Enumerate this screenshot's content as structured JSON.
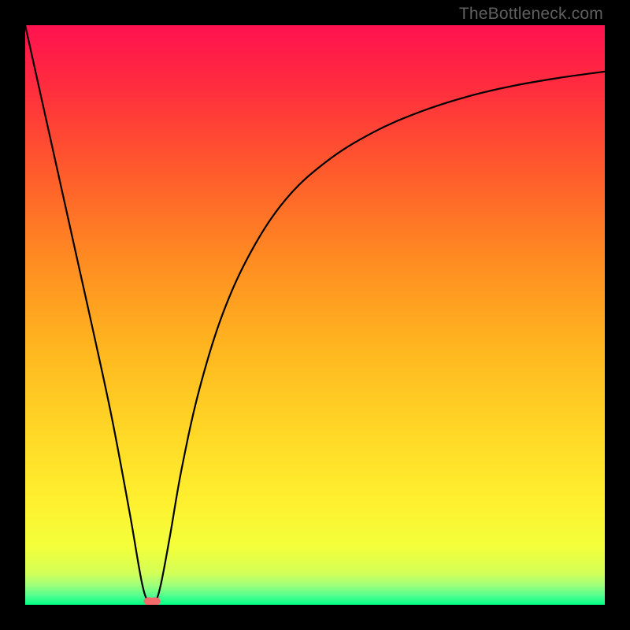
{
  "attribution": "TheBottleneck.com",
  "colors": {
    "bg_black": "#000000",
    "gradient_stops": [
      {
        "offset": 0.0,
        "color": "#ff1250"
      },
      {
        "offset": 0.1,
        "color": "#ff2b3f"
      },
      {
        "offset": 0.25,
        "color": "#ff5a2c"
      },
      {
        "offset": 0.4,
        "color": "#ff8a22"
      },
      {
        "offset": 0.55,
        "color": "#ffb41f"
      },
      {
        "offset": 0.7,
        "color": "#ffd726"
      },
      {
        "offset": 0.82,
        "color": "#fff02f"
      },
      {
        "offset": 0.9,
        "color": "#f3ff3a"
      },
      {
        "offset": 0.945,
        "color": "#d4ff57"
      },
      {
        "offset": 0.965,
        "color": "#a2ff78"
      },
      {
        "offset": 0.983,
        "color": "#58ff8e"
      },
      {
        "offset": 1.0,
        "color": "#00ff87"
      }
    ],
    "curve_stroke": "#000000",
    "marker_fill": "#f26a6a"
  },
  "chart_data": {
    "type": "line",
    "title": "",
    "xlabel": "",
    "ylabel": "",
    "xlim": [
      0,
      1
    ],
    "ylim": [
      0,
      1
    ],
    "series": [
      {
        "name": "bottleneck-curve",
        "x": [
          0.0,
          0.03,
          0.06,
          0.09,
          0.12,
          0.15,
          0.18,
          0.202,
          0.214,
          0.224,
          0.234,
          0.25,
          0.27,
          0.3,
          0.34,
          0.39,
          0.45,
          0.52,
          0.6,
          0.68,
          0.76,
          0.84,
          0.92,
          1.0
        ],
        "y": [
          1.0,
          0.865,
          0.73,
          0.595,
          0.46,
          0.32,
          0.16,
          0.035,
          0.005,
          0.005,
          0.035,
          0.12,
          0.235,
          0.37,
          0.5,
          0.61,
          0.7,
          0.765,
          0.815,
          0.85,
          0.876,
          0.895,
          0.909,
          0.92
        ]
      }
    ],
    "markers": [
      {
        "name": "min-marker-a",
        "x": 0.214,
        "y": 0.006
      },
      {
        "name": "min-marker-b",
        "x": 0.224,
        "y": 0.006
      }
    ]
  }
}
